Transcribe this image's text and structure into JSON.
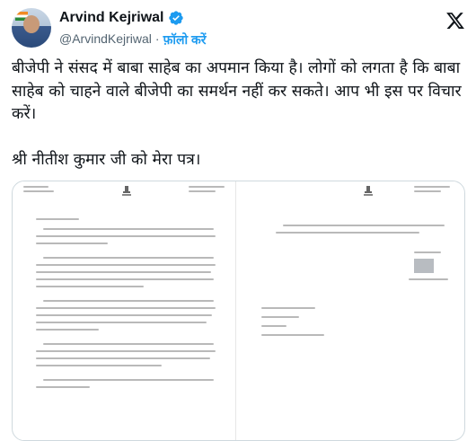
{
  "author": {
    "name": "Arvind Kejriwal",
    "handle": "@ArvindKejriwal",
    "separator": "·",
    "follow_label": "फ़ॉलो करें"
  },
  "tweet": {
    "line1": "बीजेपी ने संसद में बाबा साहेब का अपमान किया है। लोगों को लगता है कि बाबा साहेब को चाहने वाले बीजेपी का समर्थन नहीं कर सकते। आप भी इस पर विचार करें।",
    "line2": "श्री नीतीश कुमार जी को मेरा पत्र।"
  },
  "icons": {
    "verified": "verified-badge-icon",
    "x_logo": "x-logo-icon"
  },
  "colors": {
    "verified": "#1d9bf0",
    "follow": "#1d9bf0"
  }
}
